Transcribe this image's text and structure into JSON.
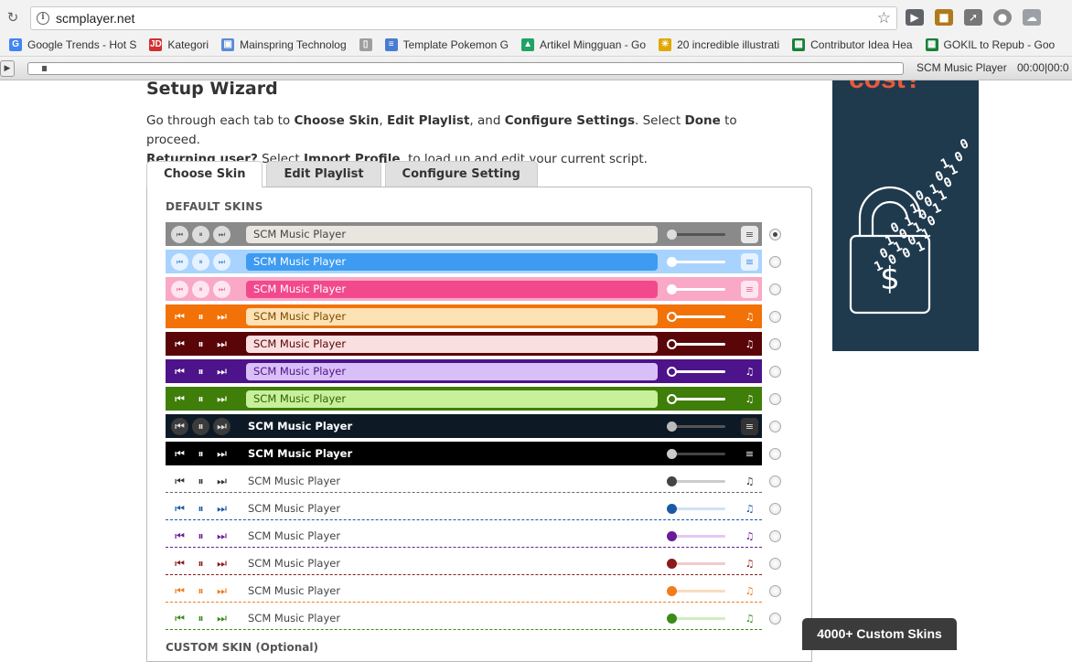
{
  "browser": {
    "url": "scmplayer.net",
    "bookmarks": [
      {
        "label": "Google Trends - Hot S",
        "icon": "google-icon",
        "color": "#4285f4"
      },
      {
        "label": "Kategori",
        "icon": "jd-icon",
        "color": "#d32f2f"
      },
      {
        "label": "Mainspring Technolog",
        "icon": "mainspring-icon",
        "color": "#5b8bd6"
      },
      {
        "label": "",
        "icon": "document-icon",
        "color": "#9e9e9e"
      },
      {
        "label": "Template Pokemon G",
        "icon": "docs-icon",
        "color": "#4a7bd3"
      },
      {
        "label": "Artikel Mingguan - Go",
        "icon": "drive-icon",
        "color": "#1fa463"
      },
      {
        "label": "20 incredible illustrati",
        "icon": "bulb-icon",
        "color": "#e0a800"
      },
      {
        "label": "Contributor Idea Hea",
        "icon": "sheets-icon",
        "color": "#188038"
      },
      {
        "label": "GOKIL to Repub - Goo",
        "icon": "sheets-icon",
        "color": "#188038"
      }
    ]
  },
  "scm_bar": {
    "title": "SCM Music Player",
    "time": "00:00|00:0"
  },
  "page": {
    "title": "Setup Wizard",
    "intro_1a": "Go through each tab to ",
    "intro_1b": "Choose Skin",
    "intro_1c": ", ",
    "intro_1d": "Edit Playlist",
    "intro_1e": ", and ",
    "intro_1f": "Configure Settings",
    "intro_1g": ". Select ",
    "intro_1h": "Done",
    "intro_1i": " to proceed.",
    "intro_2a": "Returning user?",
    "intro_2b": " Select ",
    "intro_2c": "Import Profile",
    "intro_2d": ", to load up and edit your current script."
  },
  "tabs": [
    {
      "label": "Choose Skin"
    },
    {
      "label": "Edit Playlist"
    },
    {
      "label": "Configure Setting"
    }
  ],
  "panel": {
    "default_label": "DEFAULT SKINS",
    "custom_label": "CUSTOM SKIN (Optional)",
    "skins": [
      {
        "label": "SCM Music Player",
        "style": "box",
        "bg": "#8a8a8a",
        "box": "#e9e6df",
        "text": "#444",
        "btn": "#dcdcdc",
        "btnText": "#555",
        "vol": "#555",
        "knob": "#ddd",
        "list": "#e8e8e8",
        "listText": "#555",
        "selected": true
      },
      {
        "label": "SCM Music Player",
        "style": "box",
        "bg": "#a9d3ff",
        "box": "#3d9bf2",
        "text": "#fff",
        "btn": "#e6f2ff",
        "btnText": "#3d8fe0",
        "vol": "#fff",
        "knob": "#fff",
        "list": "#e6f2ff",
        "listText": "#3d8fe0",
        "selected": false
      },
      {
        "label": "SCM Music Player",
        "style": "box",
        "bg": "#f9a8c6",
        "box": "#f2498d",
        "text": "#fff",
        "btn": "#fde6ef",
        "btnText": "#ee6ba0",
        "vol": "#fff",
        "knob": "#fff",
        "list": "#fde6ef",
        "listText": "#ee6ba0",
        "selected": false
      },
      {
        "label": "SCM Music Player",
        "style": "box",
        "bg": "#f27207",
        "box": "#fde2b6",
        "text": "#7a4b00",
        "btn": "transparent",
        "btnText": "#fff",
        "vol": "#fff",
        "knob": "#fff",
        "list": "transparent",
        "listText": "#fff",
        "selected": false
      },
      {
        "label": "SCM Music Player",
        "style": "box",
        "bg": "#5a0508",
        "box": "#f9dfe0",
        "text": "#5a0508",
        "btn": "transparent",
        "btnText": "#fff",
        "vol": "#fff",
        "knob": "#fff",
        "list": "transparent",
        "listText": "#fff",
        "selected": false
      },
      {
        "label": "SCM Music Player",
        "style": "box",
        "bg": "#4d138a",
        "box": "#d9bff7",
        "text": "#4d138a",
        "btn": "transparent",
        "btnText": "#fff",
        "vol": "#fff",
        "knob": "#fff",
        "list": "transparent",
        "listText": "#fff",
        "selected": false
      },
      {
        "label": "SCM Music Player",
        "style": "box",
        "bg": "#3f7e08",
        "box": "#c8f09a",
        "text": "#2f5f06",
        "btn": "transparent",
        "btnText": "#fff",
        "vol": "#fff",
        "knob": "#fff",
        "list": "transparent",
        "listText": "#fff",
        "selected": false
      },
      {
        "label": "SCM Music Player",
        "style": "plain",
        "bg": "#0d1a26",
        "text": "#fff",
        "btn": "#3b3b3b",
        "btnText": "#ddd",
        "vol": "#555",
        "knob": "#bbb",
        "list": "#333",
        "listText": "#ddd",
        "selected": false
      },
      {
        "label": "SCM Music Player",
        "style": "plain",
        "bg": "#000000",
        "text": "#fff",
        "btn": "transparent",
        "btnText": "#fff",
        "vol": "#444",
        "knob": "#ccc",
        "list": "transparent",
        "listText": "#fff",
        "selected": false
      },
      {
        "label": "SCM Music Player",
        "style": "line",
        "bg": "#ffffff",
        "text": "#444",
        "btn": "transparent",
        "btnText": "#333",
        "vol": "#ccc",
        "knob": "#444",
        "list": "transparent",
        "listText": "#333",
        "line": "#666",
        "selected": false
      },
      {
        "label": "SCM Music Player",
        "style": "line",
        "bg": "#ffffff",
        "text": "#444",
        "btn": "transparent",
        "btnText": "#1a5aa5",
        "vol": "#cfe3f7",
        "knob": "#1a5aa5",
        "list": "transparent",
        "listText": "#1a5aa5",
        "line": "#1a5aa5",
        "selected": false
      },
      {
        "label": "SCM Music Player",
        "style": "line",
        "bg": "#ffffff",
        "text": "#444",
        "btn": "transparent",
        "btnText": "#6a1b9a",
        "vol": "#e3c8f5",
        "knob": "#6a1b9a",
        "list": "transparent",
        "listText": "#6a1b9a",
        "line": "#6a1b9a",
        "selected": false
      },
      {
        "label": "SCM Music Player",
        "style": "line",
        "bg": "#ffffff",
        "text": "#444",
        "btn": "transparent",
        "btnText": "#8b1a1a",
        "vol": "#f2caca",
        "knob": "#8b1a1a",
        "list": "transparent",
        "listText": "#8b1a1a",
        "line": "#8b1a1a",
        "selected": false
      },
      {
        "label": "SCM Music Player",
        "style": "line",
        "bg": "#ffffff",
        "text": "#444",
        "btn": "transparent",
        "btnText": "#f07c1b",
        "vol": "#fbdcc0",
        "knob": "#f07c1b",
        "list": "transparent",
        "listText": "#f07c1b",
        "line": "#f07c1b",
        "selected": false
      },
      {
        "label": "SCM Music Player",
        "style": "line",
        "bg": "#ffffff",
        "text": "#444",
        "btn": "transparent",
        "btnText": "#3b8a1a",
        "vol": "#cfeec0",
        "knob": "#3b8a1a",
        "list": "transparent",
        "listText": "#3b8a1a",
        "line": "#3b8a1a",
        "selected": false
      }
    ]
  },
  "ad": {
    "headline": "cost?",
    "binary": [
      "0",
      "1 0",
      "0 1",
      "0 1 0",
      "1 0 1",
      "0 1 0 1",
      "1 0 1 0",
      "0 1 0 1",
      "1 0 0 1"
    ],
    "currency": "$",
    "bg": "#1f3a4d",
    "accent": "#e8593b"
  },
  "footer_button": "4000+ Custom Skins"
}
